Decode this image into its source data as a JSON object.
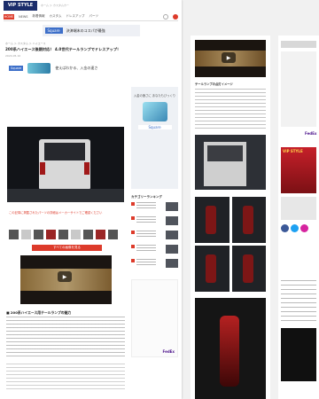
{
  "page1": {
    "logo": "VIP STYLE",
    "breadcrumb_top": "ホーム ＞ カスタムカー",
    "nav": [
      "HOME",
      "NEWS",
      "新着情報",
      "カスタム",
      "ドレスアップ",
      "パーツ"
    ],
    "banner": {
      "badge": "Square",
      "text": "決済端末のコスパが最強"
    },
    "breadcrumb": "ホーム ＞ カスタム ＞ ハイエース",
    "title": "200系ハイエース後期対応！ 4.0世代テールランプでドレスアップ！",
    "meta": "2024.05.10",
    "mid_ad": {
      "badge": "Square",
      "text": "使えばわかる、入金の速さ"
    },
    "side_ad": {
      "head": "入金の速さに あなたもびっくり",
      "brand": "Square"
    },
    "ranking_title": "カテゴリーランキング",
    "red_note": "この記事に掲載されたパーツの詳細はメーカーサイトでご確認ください",
    "red_button": "すべての画像を見る",
    "section_head": "■ 200系ハイエース用テールランプの魅力",
    "side_ad2_brand": "FedEx"
  },
  "page2": {
    "caption": "テールランプの点灯イメージ"
  },
  "page3": {
    "fed": "FedEx",
    "mag": "VIP STYLE"
  },
  "colors": {
    "accent": "#dd3b2b",
    "square": "#3d6fc9",
    "fedex": "#4d148c"
  }
}
